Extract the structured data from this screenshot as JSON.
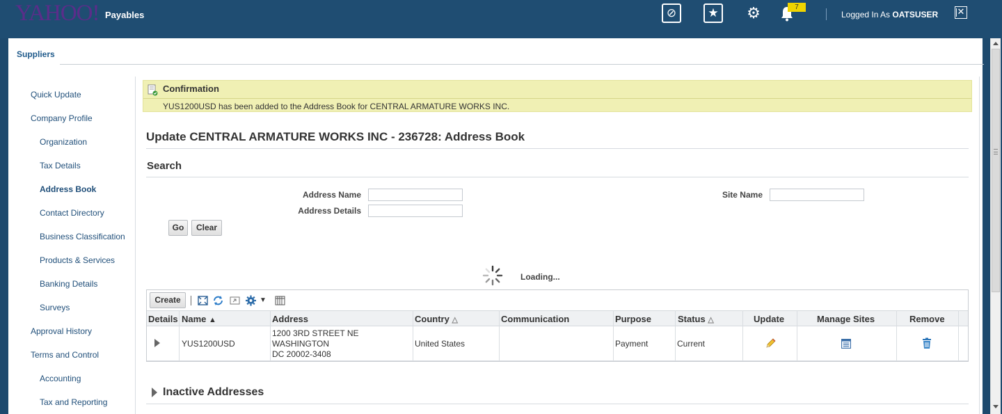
{
  "header": {
    "brand": "YAHOO!",
    "app_title": "Payables",
    "notifications_count": "7",
    "logged_in_prefix": "Logged In As",
    "user": "OATSUSER"
  },
  "tabs": {
    "suppliers": "Suppliers"
  },
  "nav": {
    "items": [
      {
        "label": "Quick Update"
      },
      {
        "label": "Company Profile"
      },
      {
        "label": "Organization"
      },
      {
        "label": "Tax Details"
      },
      {
        "label": "Address Book"
      },
      {
        "label": "Contact Directory"
      },
      {
        "label": "Business Classification"
      },
      {
        "label": "Products & Services"
      },
      {
        "label": "Banking Details"
      },
      {
        "label": "Surveys"
      },
      {
        "label": "Approval History"
      },
      {
        "label": "Terms and Control"
      },
      {
        "label": "Accounting"
      },
      {
        "label": "Tax and Reporting"
      }
    ],
    "active": "Address Book"
  },
  "confirmation": {
    "title": "Confirmation",
    "message": "YUS1200USD has been added to the Address Book for CENTRAL ARMATURE WORKS INC."
  },
  "page_title": "Update CENTRAL ARMATURE WORKS INC - 236728: Address Book",
  "search": {
    "heading": "Search",
    "address_name_label": "Address Name",
    "address_name_value": "",
    "address_details_label": "Address Details",
    "address_details_value": "",
    "site_name_label": "Site Name",
    "site_name_value": "",
    "go_label": "Go",
    "clear_label": "Clear"
  },
  "loading_text": "Loading...",
  "toolbar": {
    "create_label": "Create"
  },
  "table": {
    "headers": {
      "details": "Details",
      "name": "Name",
      "address": "Address",
      "country": "Country",
      "communication": "Communication",
      "purpose": "Purpose",
      "status": "Status",
      "update": "Update",
      "manage_sites": "Manage Sites",
      "remove": "Remove"
    },
    "rows": [
      {
        "name": "YUS1200USD",
        "address_line1": "1200 3RD STREET NE",
        "address_line2": "WASHINGTON",
        "address_line3": "DC 20002-3408",
        "country": "United States",
        "communication": "",
        "purpose": "Payment",
        "status": "Current"
      }
    ]
  },
  "inactive_heading": "Inactive Addresses"
}
